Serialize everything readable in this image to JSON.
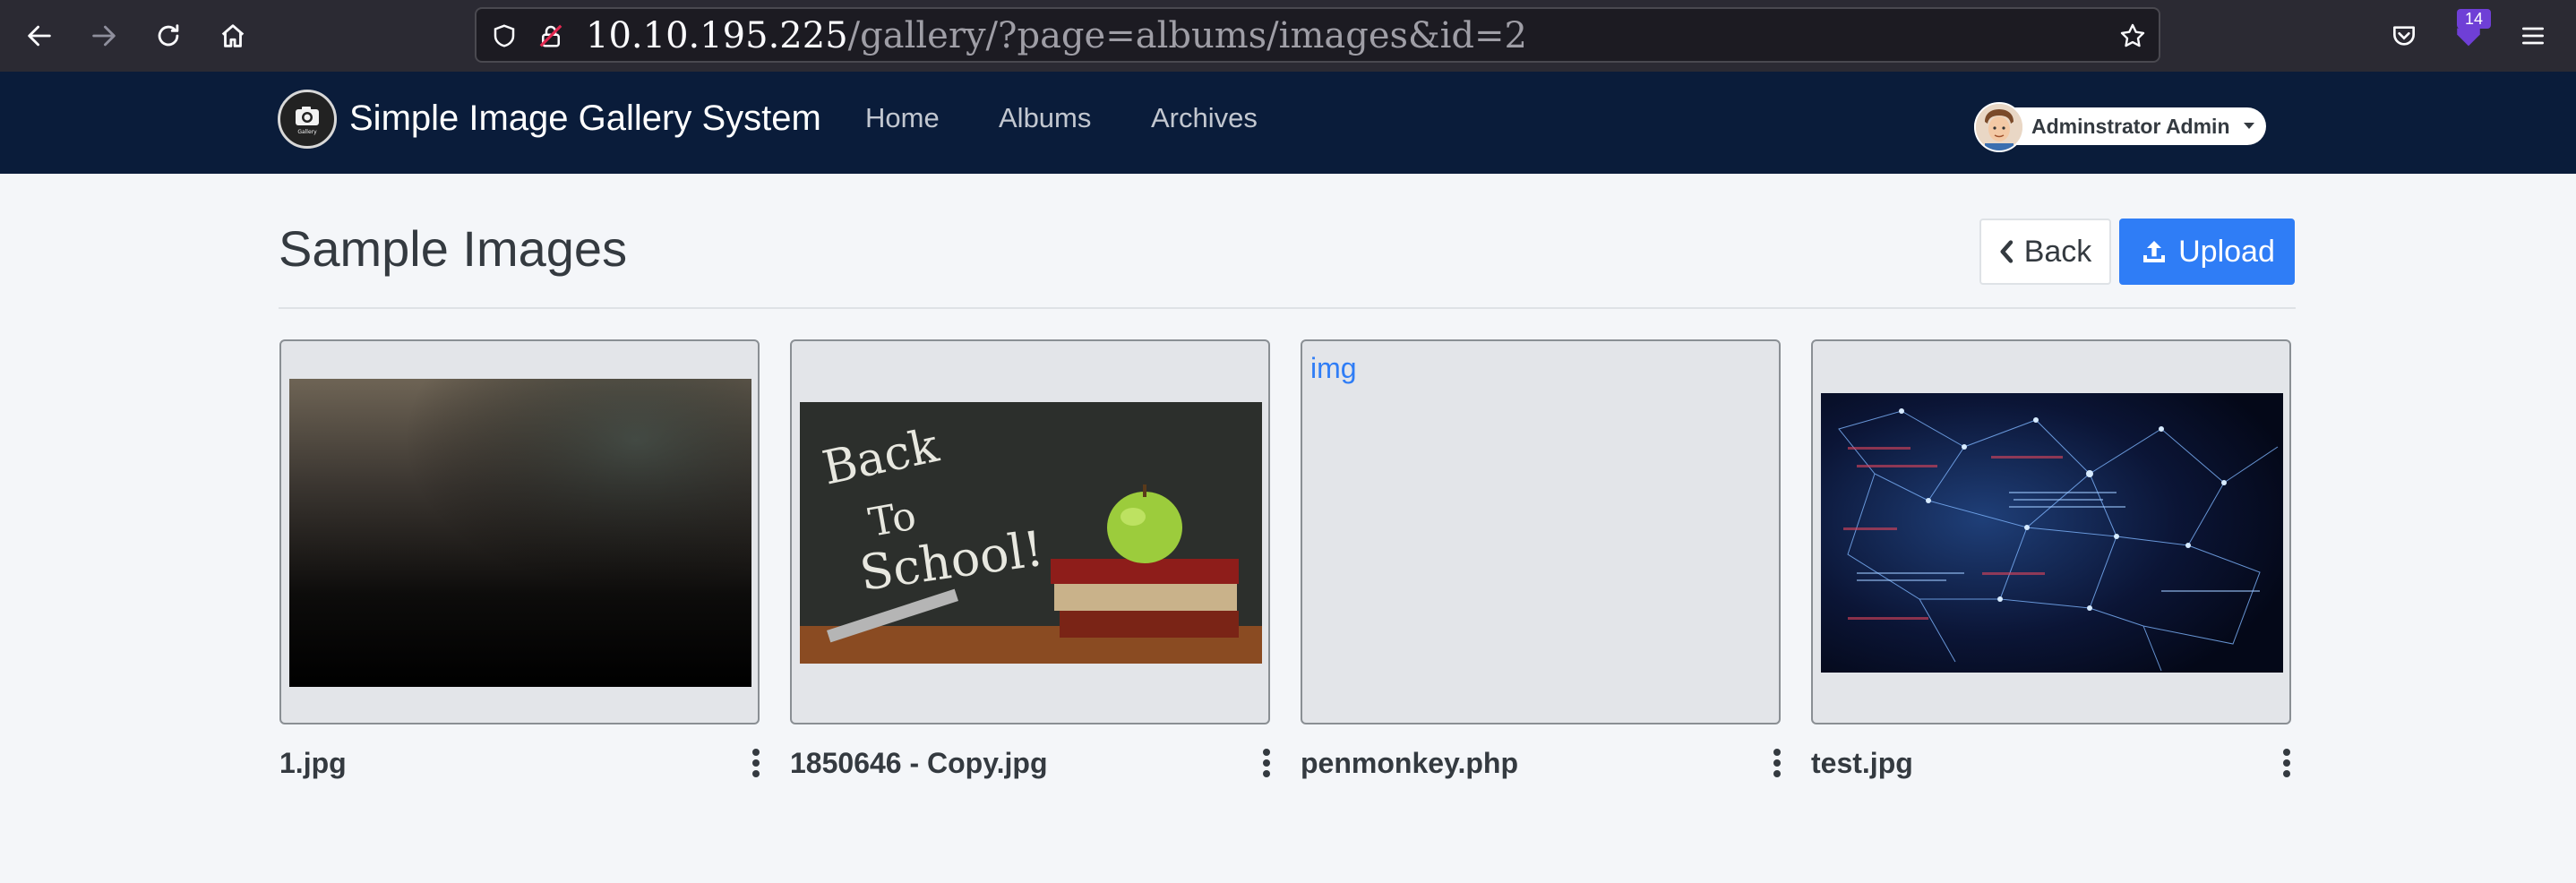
{
  "browser": {
    "url_host": "10.10.195.225",
    "url_path": "/gallery/?page=albums/images&id=2",
    "extensions_badge": "14"
  },
  "app": {
    "brand": "Simple Image Gallery System",
    "logo_text": "Gallery",
    "nav": [
      "Home",
      "Albums",
      "Archives"
    ],
    "user": "Adminstrator Admin"
  },
  "page": {
    "title": "Sample Images",
    "back_label": "Back",
    "upload_label": "Upload"
  },
  "images": [
    {
      "name": "1.jpg"
    },
    {
      "name": "1850646 - Copy.jpg",
      "chalk_text": [
        "Back",
        "To",
        "School!"
      ]
    },
    {
      "name": "penmonkey.php",
      "alt": "img"
    },
    {
      "name": "test.jpg"
    }
  ],
  "colors": {
    "navbar": "#0a1c3a",
    "accent": "#2f7df6",
    "page_bg": "#f4f6f9"
  }
}
